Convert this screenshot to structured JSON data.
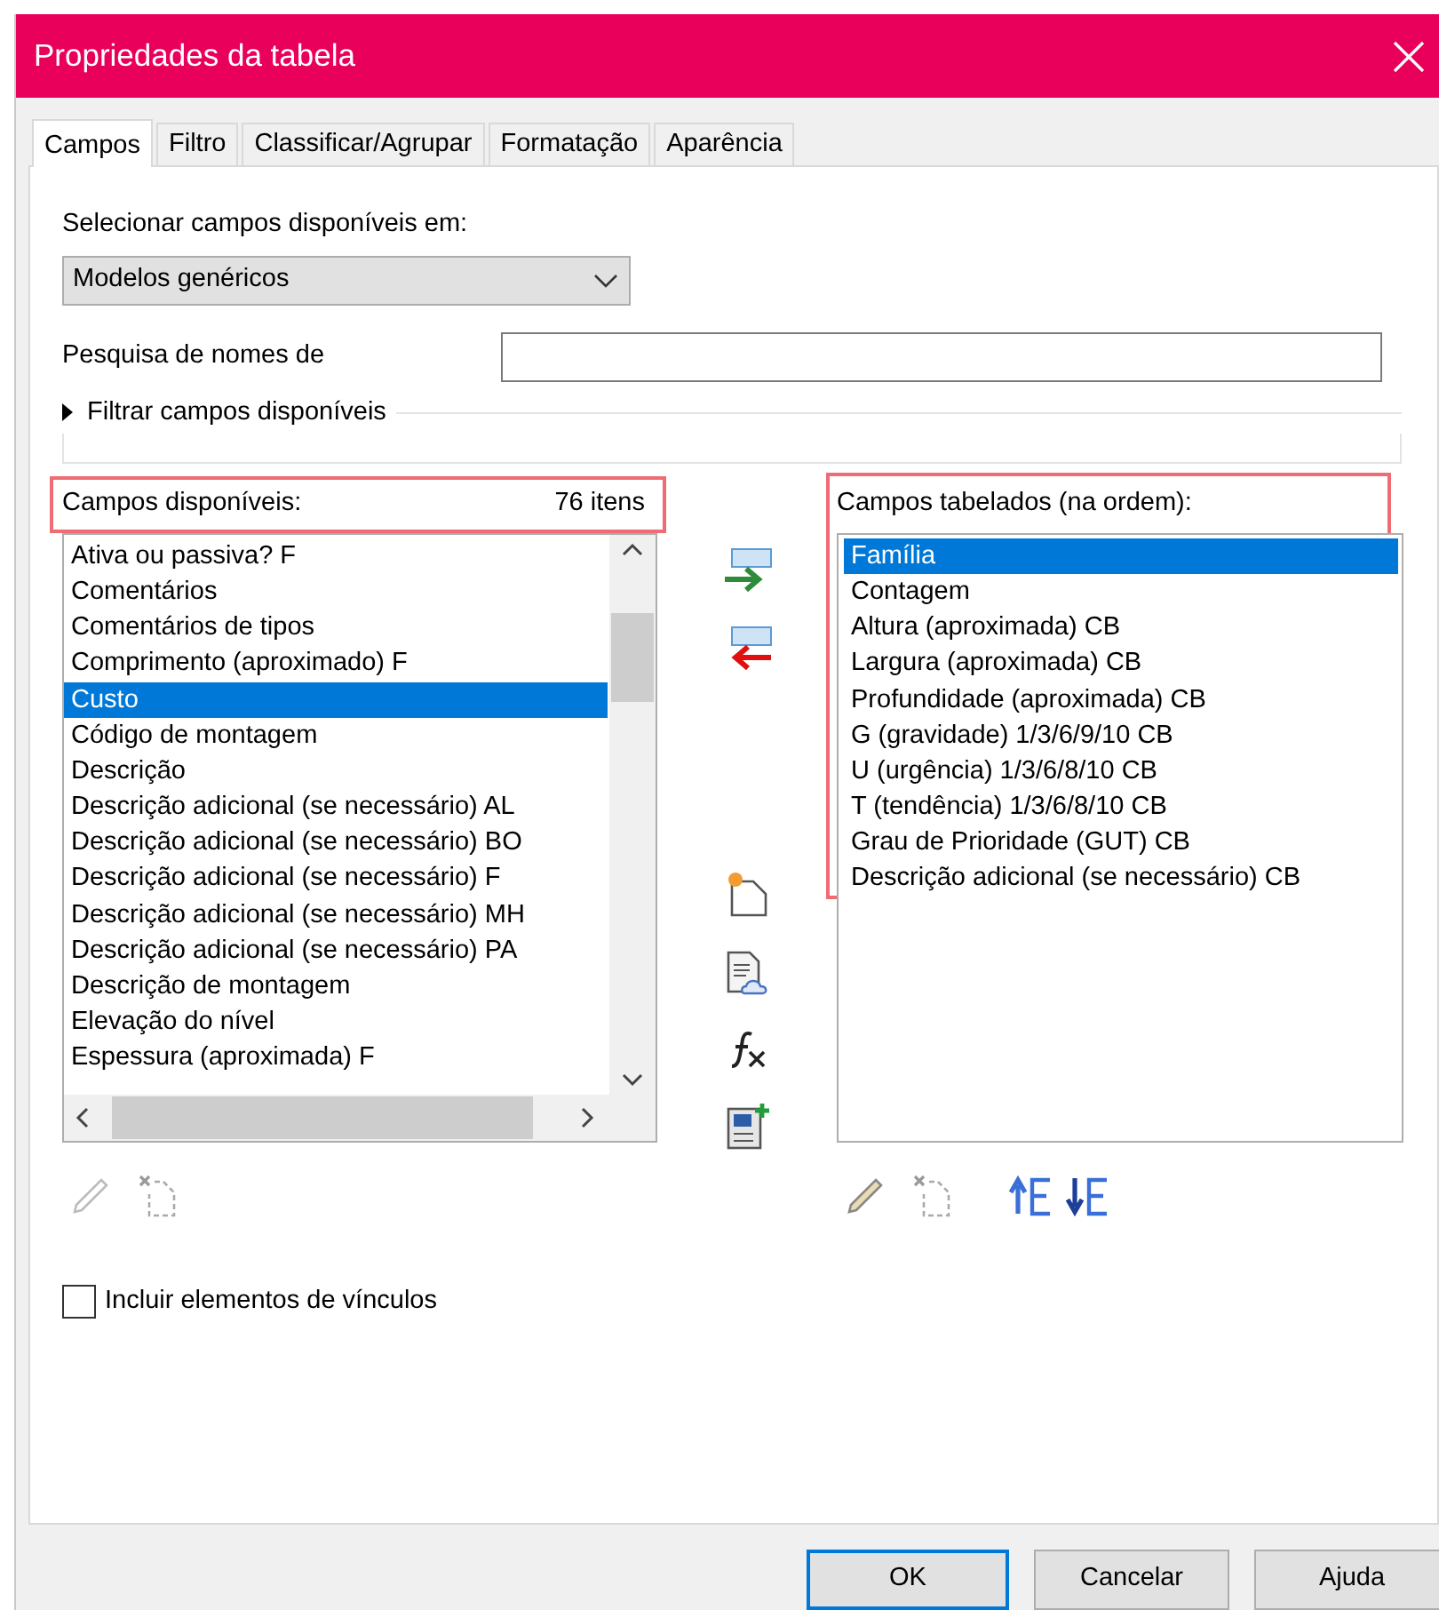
{
  "window": {
    "title": "Propriedades da tabela"
  },
  "tabs": [
    {
      "label": "Campos",
      "selected": true
    },
    {
      "label": "Filtro",
      "selected": false
    },
    {
      "label": "Classificar/Agrupar",
      "selected": false
    },
    {
      "label": "Formatação",
      "selected": false
    },
    {
      "label": "Aparência",
      "selected": false
    }
  ],
  "source": {
    "label": "Selecionar campos disponíveis em:",
    "value": "Modelos genéricos"
  },
  "search": {
    "label": "Pesquisa de nomes de"
  },
  "filter": {
    "label": "Filtrar campos disponíveis",
    "expanded": false
  },
  "available": {
    "label": "Campos disponíveis:",
    "count": "76 itens",
    "highlighted": true,
    "items": [
      {
        "label": "Ativa ou passiva? F",
        "selected": false
      },
      {
        "label": "Comentários",
        "selected": false
      },
      {
        "label": "Comentários de tipos",
        "selected": false
      },
      {
        "label": "Comprimento (aproximado) F",
        "selected": false
      },
      {
        "label": "Custo",
        "selected": true
      },
      {
        "label": "Código de montagem",
        "selected": false
      },
      {
        "label": "Descrição",
        "selected": false
      },
      {
        "label": "Descrição adicional (se necessário) AL",
        "selected": false
      },
      {
        "label": "Descrição adicional (se necessário) BO",
        "selected": false
      },
      {
        "label": "Descrição adicional (se necessário) F",
        "selected": false
      },
      {
        "label": "Descrição adicional (se necessário) MH",
        "selected": false
      },
      {
        "label": "Descrição adicional (se necessário) PA",
        "selected": false
      },
      {
        "label": "Descrição de montagem",
        "selected": false
      },
      {
        "label": "Elevação do nível",
        "selected": false
      },
      {
        "label": "Espessura (aproximada) F",
        "selected": false
      }
    ]
  },
  "scheduled": {
    "label": "Campos tabelados (na ordem):",
    "highlighted": true,
    "items": [
      {
        "label": "Família",
        "selected": true
      },
      {
        "label": "Contagem",
        "selected": false
      },
      {
        "label": "Altura (aproximada) CB",
        "selected": false
      },
      {
        "label": "Largura (aproximada) CB",
        "selected": false
      },
      {
        "label": "Profundidade (aproximada) CB",
        "selected": false
      },
      {
        "label": "G (gravidade) 1/3/6/9/10 CB",
        "selected": false
      },
      {
        "label": "U (urgência) 1/3/6/8/10 CB",
        "selected": false
      },
      {
        "label": "T (tendência) 1/3/6/8/10 CB",
        "selected": false
      },
      {
        "label": "Grau de Prioridade (GUT) CB",
        "selected": false
      },
      {
        "label": "Descrição adicional (se necessário) CB",
        "selected": false
      }
    ]
  },
  "include_links": {
    "label": "Incluir elementos de vínculos",
    "checked": false
  },
  "buttons": [
    {
      "label": "OK",
      "default": true
    },
    {
      "label": "Cancelar",
      "default": false
    },
    {
      "label": "Ajuda",
      "default": false
    }
  ]
}
